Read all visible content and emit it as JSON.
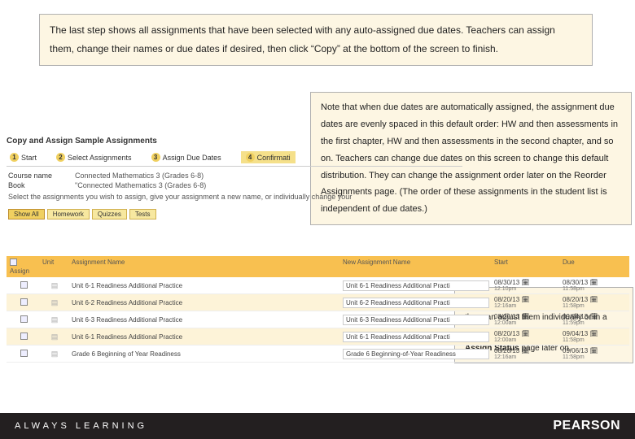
{
  "annot1": "The last step shows all assignments that have been selected with any auto-assigned due dates. Teachers can assign them, change their names or due dates if desired, then click “Copy” at the bottom of the screen to finish.",
  "annot2": "Note that when due dates are automatically assigned, the assignment due dates are evenly spaced in this default order: HW and then assessments in the first chapter, HW and then assessments in the second chapter, and so on. Teachers can change due dates on this screen to change this default distribution. They can change the assignment order later on the Reorder Assignments page. (The order of these assignments in the student list is independent of due dates.)",
  "annot3_prefix": "If teachers don't adjust due dates here, they can adjust them individually or in a batch mode on the ",
  "annot3_bold": "Change Dates & Assign Status",
  "annot3_suffix": " page later on.",
  "sc": {
    "title": "Copy and Assign Sample Assignments",
    "tabs": {
      "t1": "Start",
      "t2": "Select Assignments",
      "t3": "Assign Due Dates",
      "t4": "Confirmati"
    },
    "course_lbl": "Course name",
    "course": "Connected Mathematics 3 (Grades 6-8)",
    "book_lbl": "Book",
    "book": "\"Connected Mathematics 3 (Grades 6-8)",
    "instr": "Select the assignments you wish to assign, give your assignment a new name, or individually change your",
    "filters": {
      "all": "Show All",
      "hw": "Homework",
      "qz": "Quizzes",
      "ts": "Tests"
    }
  },
  "cols": {
    "c1": "Assign",
    "c2": "Unit",
    "c3": "Assignment Name",
    "c4": "New Assignment Name",
    "c5": "Start",
    "c6": "Due"
  },
  "rows": [
    {
      "name": "Unit 6-1 Readiness Additional Practice",
      "new": "Unit 6-1 Readiness Additional Practi",
      "s": "08/30/13",
      "st": "12:10pm",
      "d": "08/30/13",
      "dt": "11:58pm",
      "alt": false
    },
    {
      "name": "Unit 6-2 Readiness Additional Practice",
      "new": "Unit 6-2 Readiness Additional Practi",
      "s": "08/20/13",
      "st": "12:16am",
      "d": "08/20/13",
      "dt": "11:58pm",
      "alt": true
    },
    {
      "name": "Unit 6-3 Readiness Additional Practice",
      "new": "Unit 6-3 Readiness Additional Practi",
      "s": "08/20/13",
      "st": "12:00am",
      "d": "09/04/13",
      "dt": "11:59pm",
      "alt": false
    },
    {
      "name": "Unit 6-1 Readiness Additional Practice",
      "new": "Unit 6-1 Readiness Additional Practi",
      "s": "08/20/13",
      "st": "12:00am",
      "d": "09/04/13",
      "dt": "11:58pm",
      "alt": true
    },
    {
      "name": "Grade 6 Beginning of Year Readiness",
      "new": "Grade 6 Beginning-of-Year Readiness",
      "s": "08/20/13",
      "st": "12:16am",
      "d": "09/06/13",
      "dt": "11:58pm",
      "alt": false
    }
  ],
  "footer": {
    "tag": "ALWAYS LEARNING",
    "brand": "PEARSON"
  }
}
